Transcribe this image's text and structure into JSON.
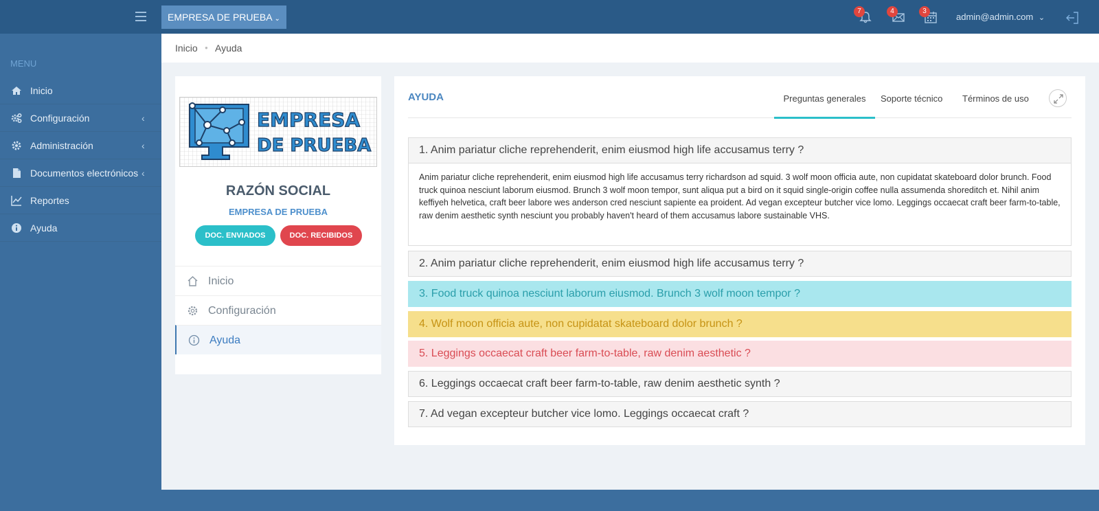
{
  "topbar": {
    "company": "EMPRESA DE PRUEBA",
    "notifications": {
      "count": "7",
      "icon": "bell-icon"
    },
    "messages": {
      "count": "4",
      "icon": "envelope-icon"
    },
    "calendar": {
      "count": "3",
      "icon": "calendar-icon"
    },
    "user": "admin@admin.com"
  },
  "sidebar": {
    "menu_title": "MENU",
    "items": [
      {
        "label": "Inicio",
        "icon": "home-icon",
        "has_children": false
      },
      {
        "label": "Configuración",
        "icon": "cogs-icon",
        "has_children": true
      },
      {
        "label": "Administración",
        "icon": "gear-icon",
        "has_children": true
      },
      {
        "label": "Documentos electrónicos",
        "icon": "file-icon",
        "has_children": true
      },
      {
        "label": "Reportes",
        "icon": "chart-line-icon",
        "has_children": false
      },
      {
        "label": "Ayuda",
        "icon": "info-icon",
        "has_children": false
      }
    ]
  },
  "breadcrumb": {
    "home": "Inicio",
    "current": "Ayuda"
  },
  "profile": {
    "logo_line1": "EMPRESA",
    "logo_line2": "DE PRUEBA",
    "title": "RAZÓN SOCIAL",
    "subtitle": "EMPRESA DE PRUEBA",
    "btn_sent": "DOC. ENVIADOS",
    "btn_received": "DOC. RECIBIDOS",
    "nav": [
      {
        "label": "Inicio",
        "icon": "home-outline-icon"
      },
      {
        "label": "Configuración",
        "icon": "gear-outline-icon"
      },
      {
        "label": "Ayuda",
        "icon": "info-circle-icon"
      }
    ]
  },
  "help": {
    "title": "AYUDA",
    "tabs": [
      "Preguntas generales",
      "Soporte técnico",
      "Términos de uso"
    ],
    "active_tab": "Preguntas generales",
    "faq": [
      "1. Anim pariatur cliche reprehenderit, enim eiusmod high life accusamus terry ?",
      "2. Anim pariatur cliche reprehenderit, enim eiusmod high life accusamus terry ?",
      "3. Food truck quinoa nesciunt laborum eiusmod. Brunch 3 wolf moon tempor ?",
      "4. Wolf moon officia aute, non cupidatat skateboard dolor brunch ?",
      "5. Leggings occaecat craft beer farm-to-table, raw denim aesthetic ?",
      "6. Leggings occaecat craft beer farm-to-table, raw denim aesthetic synth ?",
      "7. Ad vegan excepteur butcher vice lomo. Leggings occaecat craft ?"
    ],
    "answer_1": "Anim pariatur cliche reprehenderit, enim eiusmod high life accusamus terry richardson ad squid. 3 wolf moon officia aute, non cupidatat skateboard dolor brunch. Food truck quinoa nesciunt laborum eiusmod. Brunch 3 wolf moon tempor, sunt aliqua put a bird on it squid single-origin coffee nulla assumenda shoreditch et. Nihil anim keffiyeh helvetica, craft beer labore wes anderson cred nesciunt sapiente ea proident. Ad vegan excepteur butcher vice lomo. Leggings occaecat craft beer farm-to-table, raw denim aesthetic synth nesciunt you probably haven't heard of them accusamus labore sustainable VHS."
  },
  "colors": {
    "topbar": "#2a5a87",
    "sidebar": "#3c6e9e",
    "accent_info": "#2bbfc9",
    "accent_danger": "#e0464e",
    "accent_warning": "#f6df8c"
  }
}
